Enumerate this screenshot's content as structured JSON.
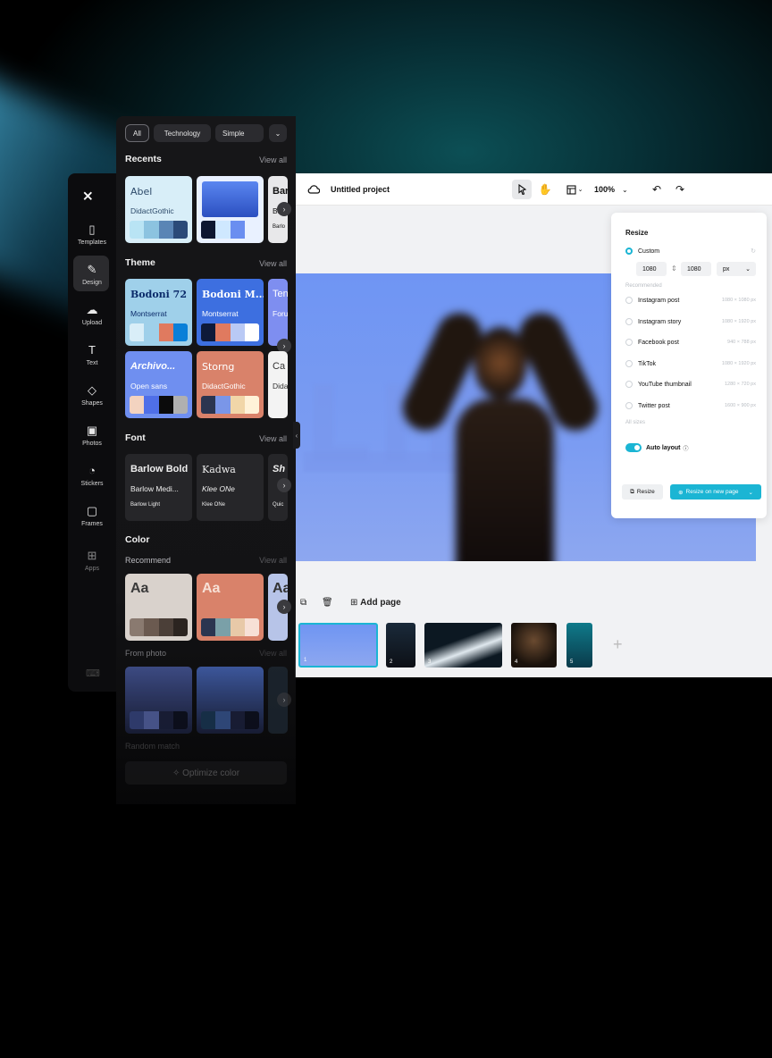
{
  "editor": {
    "project_title": "Untitled project",
    "zoom": "100%",
    "canvas_text": "LIFE",
    "add_page_label": "Add page",
    "pages": [
      "1",
      "2",
      "3",
      "4",
      "5"
    ]
  },
  "resize": {
    "title": "Resize",
    "custom_label": "Custom",
    "width": "1080",
    "height": "1080",
    "unit": "px",
    "recommended_label": "Recommended",
    "options": [
      {
        "label": "Instagram post",
        "size": "1080 × 1080 px"
      },
      {
        "label": "Instagram story",
        "size": "1080 × 1920 px"
      },
      {
        "label": "Facebook post",
        "size": "940 × 788 px"
      },
      {
        "label": "TikTok",
        "size": "1080 × 1920 px"
      },
      {
        "label": "YouTube thumbnail",
        "size": "1280 × 720 px"
      },
      {
        "label": "Twitter post",
        "size": "1600 × 900 px"
      }
    ],
    "all_sizes_label": "All sizes",
    "auto_layout_label": "Auto layout",
    "resize_button": "Resize",
    "resize_new_page_button": "Resize on new page"
  },
  "rail": {
    "items": [
      {
        "label": "Templates",
        "icon": "templates-icon"
      },
      {
        "label": "Design",
        "icon": "design-icon"
      },
      {
        "label": "Upload",
        "icon": "upload-icon"
      },
      {
        "label": "Text",
        "icon": "text-icon"
      },
      {
        "label": "Shapes",
        "icon": "shapes-icon"
      },
      {
        "label": "Photos",
        "icon": "photos-icon"
      },
      {
        "label": "Stickers",
        "icon": "stickers-icon"
      },
      {
        "label": "Frames",
        "icon": "frames-icon"
      },
      {
        "label": "Apps",
        "icon": "apps-icon"
      }
    ]
  },
  "panel": {
    "chips": [
      "All",
      "Technology",
      "Simple"
    ],
    "view_all": "View all",
    "recents": {
      "title": "Recents",
      "cards": [
        {
          "t1": "Abel",
          "t2": "DidactGothic",
          "colors": [
            "#b9e4f4",
            "#8cc3e0",
            "#5a85b5",
            "#2b4a78"
          ]
        },
        {
          "t1": "",
          "t2": "",
          "colors": [
            "#0e1730",
            "#cfe8ff",
            "#6a8ef0",
            "#e9f1ff"
          ]
        },
        {
          "t1": "Bar",
          "t2": "Ba",
          "t3": "Barlo"
        }
      ]
    },
    "theme": {
      "title": "Theme",
      "cards": [
        {
          "t1": "Bodoni 72",
          "t2": "Montserrat",
          "colors": [
            "#d9eef8",
            "#9fd0ea",
            "#e07a5f",
            "#0a7fd8"
          ]
        },
        {
          "t1": "Bodoni M...",
          "t2": "Montserrat",
          "colors": [
            "#0e1a3a",
            "#e07a5f",
            "#b9c9f5",
            "#ffffff"
          ]
        },
        {
          "t1": "Ten",
          "t2": "Foru"
        },
        {
          "t1": "Archivo...",
          "t2": "Open sans",
          "colors": [
            "#f3d3c0",
            "#4f6fe8",
            "#0b0b0b",
            "#b0b0b0"
          ]
        },
        {
          "t1": "Storng",
          "t2": "DidactGothic",
          "colors": [
            "#2b3550",
            "#7a96e8",
            "#f1d6a8",
            "#fff2d8"
          ]
        },
        {
          "t1": "Ca",
          "t2": "Didac"
        }
      ]
    },
    "font": {
      "title": "Font",
      "cards": [
        {
          "t1": "Barlow Bold",
          "t2": "Barlow Medi...",
          "t3": "Barlow Light"
        },
        {
          "t1": "Kadwa",
          "t2": "Klee ONe",
          "t3": "Klee ONe"
        },
        {
          "t1": "Sh",
          "t2": "",
          "t3": "Quic"
        }
      ]
    },
    "color": {
      "title": "Color",
      "recommend_label": "Recommend",
      "aa": "Aa",
      "from_photo_label": "From photo",
      "random_match_label": "Random match",
      "optimize_label": "Optimize color"
    }
  },
  "colors": {
    "accent": "#1bb5d4",
    "panel_bg": "#161618",
    "canvas_blue": "#7398f3"
  }
}
